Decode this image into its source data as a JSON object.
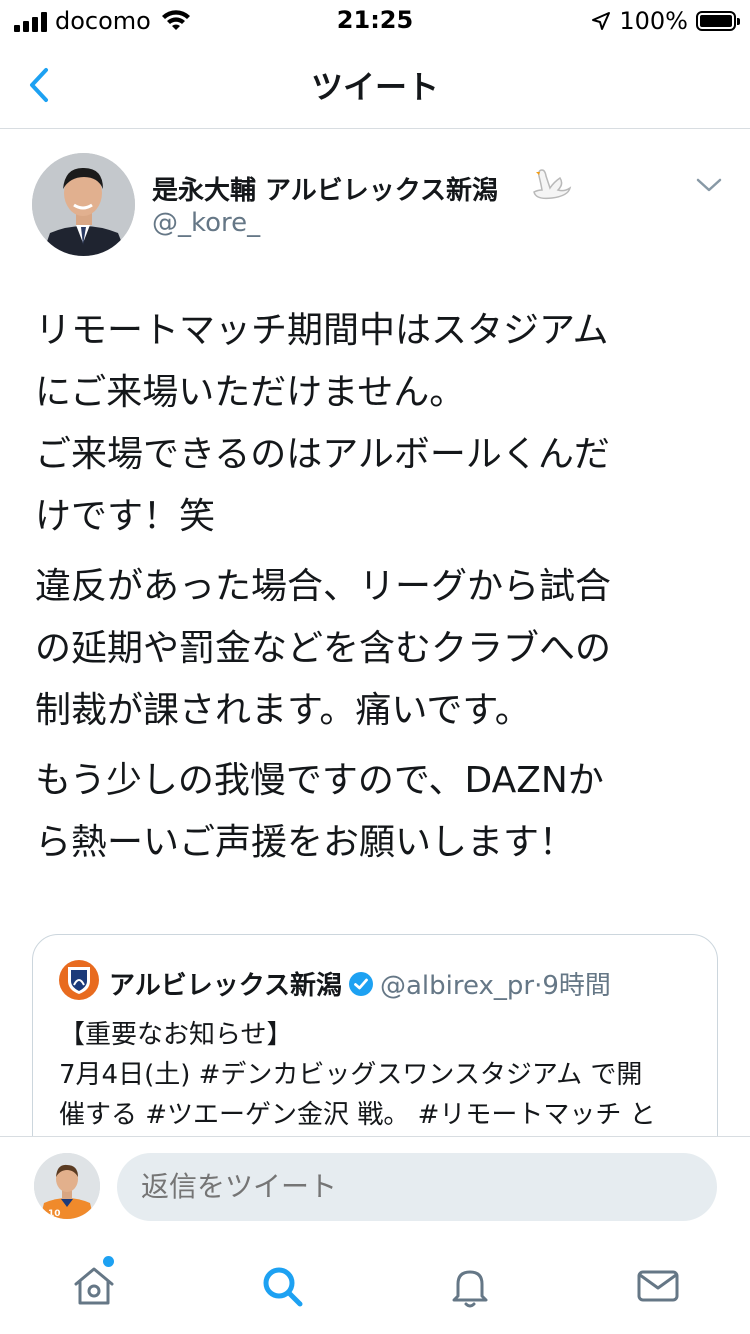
{
  "status_bar": {
    "carrier": "docomo",
    "time": "21:25",
    "battery_percent": "100%",
    "battery_level": 1.0
  },
  "nav": {
    "title": "ツイート",
    "back_icon": "chevron-left-icon"
  },
  "tweet": {
    "author_name": "是永大輔 アルビレックス新潟",
    "author_emoji": "swan",
    "author_handle": "@_kore_",
    "paragraphs": [
      "リモートマッチ期間中はスタジアム\nにご来場いただけません。\nご来場できるのはアルボールくんだ\nけです！笑",
      "違反があった場合、リーグから試合\nの延期や罰金などを含むクラブへの\n制裁が課されます。痛いです。",
      "もう少しの我慢ですので、DAZNか\nら熱ーいご声援をお願いします！"
    ]
  },
  "quoted_tweet": {
    "name": "アルビレックス新潟",
    "handle": "@albirex_pr",
    "separator": "·",
    "time": "9時間",
    "text": "【重要なお知らせ】\n7月4日(土) #デンカビッグスワンスタジアム で開\n催する #ツエーゲン金沢 戦。 #リモートマッチ と"
  },
  "reply": {
    "placeholder": "返信をツイート"
  },
  "tab_bar": {
    "items": [
      "home-icon",
      "search-icon",
      "notifications-icon",
      "messages-icon"
    ],
    "active": "search-icon",
    "accent": "#1da1f2"
  },
  "colors": {
    "accent": "#1da1f2",
    "secondary_text": "#657786",
    "divider": "#d8dde1"
  }
}
